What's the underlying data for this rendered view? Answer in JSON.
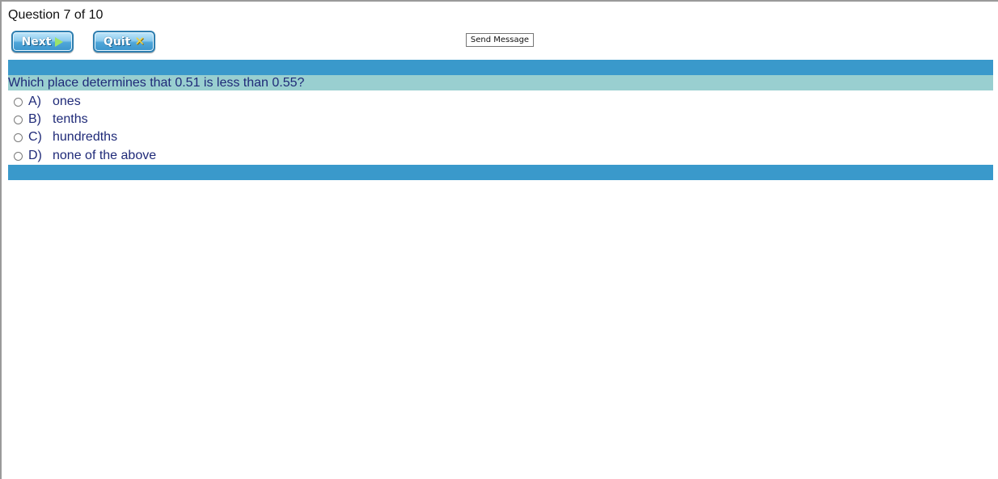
{
  "header": {
    "progress": "Question 7 of 10"
  },
  "toolbar": {
    "next_label": "Next",
    "quit_label": "Quit",
    "send_message_label": "Send Message"
  },
  "question": {
    "text": "Which place determines that 0.51 is less than 0.55?",
    "options": [
      {
        "letter": "A)",
        "text": "ones"
      },
      {
        "letter": "B)",
        "text": "tenths"
      },
      {
        "letter": "C)",
        "text": "hundredths"
      },
      {
        "letter": "D)",
        "text": "none of the above"
      }
    ]
  },
  "icons": {
    "next": "play-arrow-icon",
    "quit": "x-icon"
  },
  "colors": {
    "band": "#3a99cb",
    "question_bg": "#99cfd0",
    "text": "#1f2a78"
  }
}
